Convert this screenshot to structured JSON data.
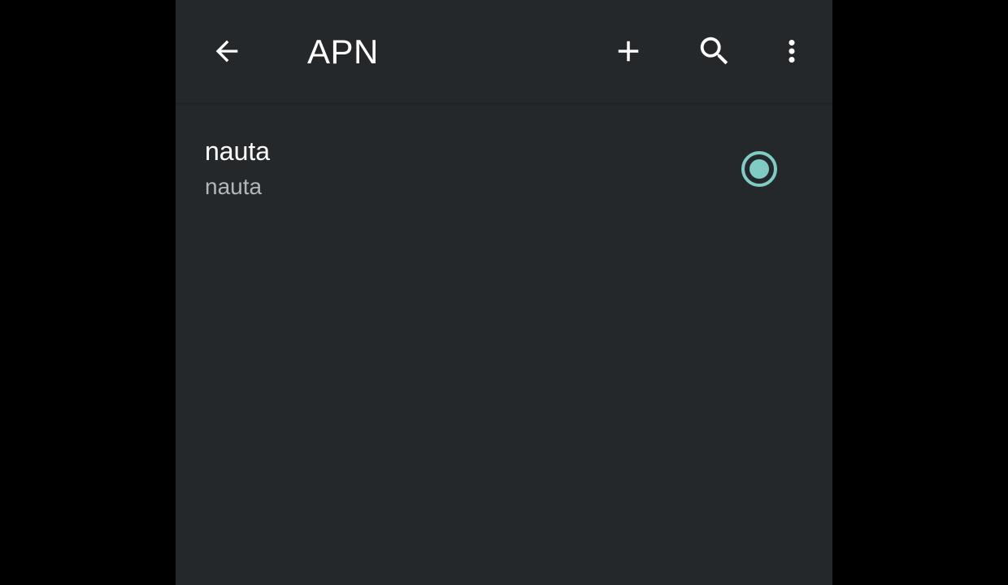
{
  "colors": {
    "background": "#25282b",
    "letterbox": "#000000",
    "accent": "#80cbc4",
    "primary_text": "#ffffff",
    "secondary_text": "#b3b6b9"
  },
  "toolbar": {
    "title": "APN",
    "back_icon": "arrow-left-icon",
    "add_icon": "plus-icon",
    "search_icon": "search-icon",
    "more_icon": "more-vert-icon"
  },
  "apn_list": [
    {
      "name": "nauta",
      "apn": "nauta",
      "selected": true
    }
  ]
}
